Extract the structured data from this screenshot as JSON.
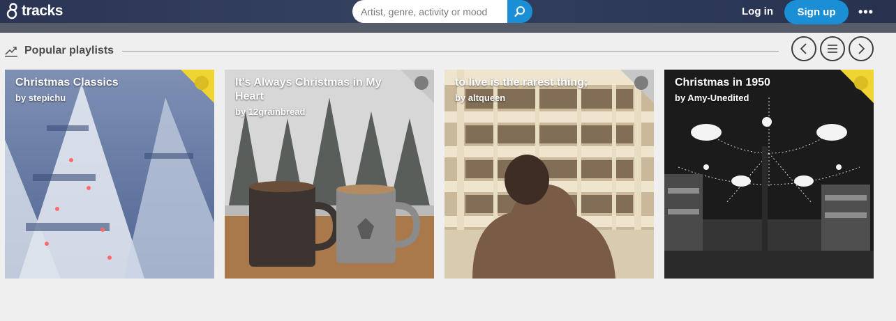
{
  "header": {
    "logo_text": "tracks",
    "search_placeholder": "Artist, genre, activity or mood",
    "login_label": "Log in",
    "signup_label": "Sign up",
    "more_label": "•••"
  },
  "section": {
    "title": "Popular playlists"
  },
  "playlists": [
    {
      "title": "Christmas Classics",
      "author": "by stepichu",
      "badge_color": "#f0d431"
    },
    {
      "title": "It's Always Christmas in My Heart",
      "author": "by 12grainbread",
      "badge_color": "#8a8a8a"
    },
    {
      "title": "to live is the rarest thing;",
      "author": "by altqueen",
      "badge_color": "#8a8a8a"
    },
    {
      "title": "Christmas in 1950",
      "author": "by Amy-Unedited",
      "badge_color": "#f0d431"
    }
  ],
  "colors": {
    "accent": "#1a8fd6",
    "header_bg": "#2e3a5a"
  }
}
